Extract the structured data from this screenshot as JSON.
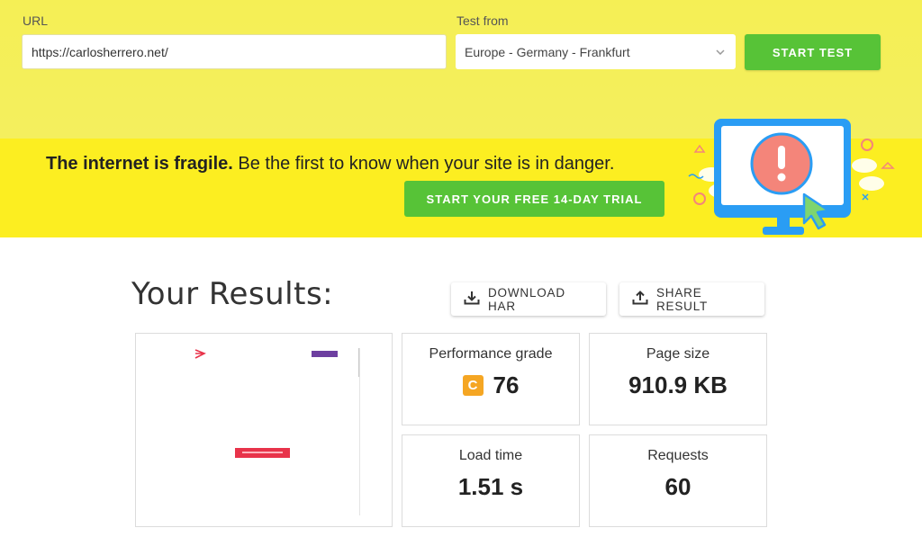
{
  "form": {
    "url_label": "URL",
    "url_value": "https://carlosherrero.net/",
    "from_label": "Test from",
    "from_value": "Europe - Germany - Frankfurt",
    "start_label": "START TEST"
  },
  "promo": {
    "bold": "The internet is fragile.",
    "rest": " Be the first to know when your site is in danger.",
    "trial_label": "START YOUR FREE 14-DAY TRIAL"
  },
  "results": {
    "title": "Your Results:",
    "download_label": "DOWNLOAD HAR",
    "share_label": "SHARE RESULT",
    "performance": {
      "label": "Performance grade",
      "grade": "C",
      "value": "76"
    },
    "page_size": {
      "label": "Page size",
      "value": "910.9 KB"
    },
    "load_time": {
      "label": "Load time",
      "value": "1.51 s"
    },
    "requests": {
      "label": "Requests",
      "value": "60"
    }
  },
  "colors": {
    "test_bar_bg": "#f5ef55",
    "promo_bg": "#fcee21",
    "green_button": "#57c337",
    "grade_c": "#f5a623",
    "monitor_blue": "#2a9df4",
    "alert_red": "#f4857a"
  },
  "icons": [
    "chevron-down-icon",
    "download-icon",
    "share-icon",
    "alert-monitor-illustration",
    "cursor-icon"
  ]
}
